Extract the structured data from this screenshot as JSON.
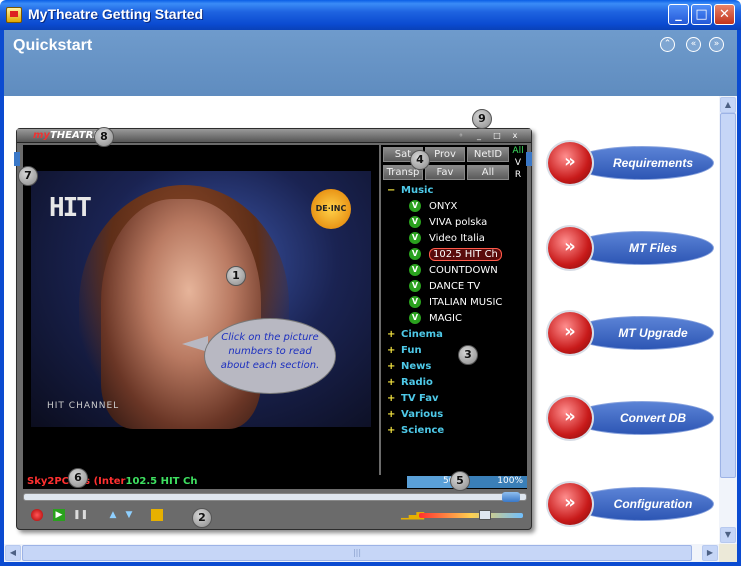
{
  "window": {
    "title": "MyTheatre Getting Started",
    "buttons": {
      "minimize": "_",
      "maximize": "□",
      "close": "✕"
    }
  },
  "header": {
    "title": "Quickstart",
    "nav_buttons": [
      "⌃",
      "«",
      "»"
    ]
  },
  "player": {
    "logo_prefix": "my",
    "logo_main": "THEATRE",
    "window_controls": [
      "◦",
      "_",
      "□",
      "x"
    ],
    "video": {
      "channel_logo": "HIT",
      "channel_caption": "HIT CHANNEL",
      "tooltip": "Click on the picture numbers to read about each section."
    },
    "filter_buttons": {
      "row1": [
        "Sat",
        "Prov",
        "NetID"
      ],
      "row2": [
        "Transp",
        "Fav",
        "All"
      ],
      "flags": [
        "All",
        "V",
        "R"
      ]
    },
    "groups": [
      {
        "sign": "−",
        "name": "Music",
        "expanded": true
      },
      {
        "sign": "+",
        "name": "Cinema"
      },
      {
        "sign": "+",
        "name": "Fun"
      },
      {
        "sign": "+",
        "name": "News"
      },
      {
        "sign": "+",
        "name": "Radio"
      },
      {
        "sign": "+",
        "name": "TV Fav"
      },
      {
        "sign": "+",
        "name": "Various"
      },
      {
        "sign": "+",
        "name": "Science"
      }
    ],
    "channels": [
      {
        "badge": "V",
        "name": "ONYX"
      },
      {
        "badge": "V",
        "name": "VIVA polska"
      },
      {
        "badge": "V",
        "name": "Video  Italia"
      },
      {
        "badge": "V",
        "name": "102.5 HIT Ch",
        "selected": true
      },
      {
        "badge": "V",
        "name": "COUNTDOWN"
      },
      {
        "badge": "V",
        "name": "DANCE TV"
      },
      {
        "badge": "V",
        "name": "ITALIAN MUSIC"
      },
      {
        "badge": "V",
        "name": "MAGIC"
      }
    ],
    "status": {
      "provider_text": "Sky2PC",
      "provider_suffix": "ries (Inter",
      "channel_text": "102.5 HIT Ch",
      "signal": "50%",
      "quality": "100%"
    }
  },
  "markers": [
    "1",
    "2",
    "3",
    "4",
    "5",
    "6",
    "7",
    "8",
    "9"
  ],
  "nav": [
    {
      "label": "Requirements"
    },
    {
      "label": "MT Files"
    },
    {
      "label": "MT Upgrade"
    },
    {
      "label": "Convert DB"
    },
    {
      "label": "Configuration"
    }
  ],
  "icons": {
    "nav_arrow": "»",
    "scroll_up": "▲",
    "scroll_down": "▼",
    "scroll_left": "◀",
    "scroll_right": "▶"
  },
  "colors": {
    "titlebar": "#0b4bd1",
    "header": "#6a98c9",
    "group_text": "#4ec9e8",
    "nav_pill": "#2d56b4",
    "nav_ring": "#c81a1a"
  }
}
